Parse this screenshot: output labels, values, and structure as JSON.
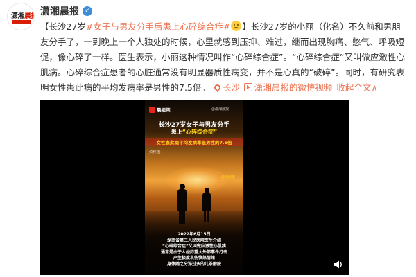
{
  "post": {
    "author": "潇湘晨报",
    "verified_icon": "verified-badge-icon",
    "avatar": {
      "line1a": "潇湘",
      "line1b": "晨报"
    },
    "segments": {
      "bracket_open": "【",
      "city": "长沙27岁",
      "hashtag": "#女子与男友分手后患上心碎综合症#",
      "emoji_icon": "sad-face-emoji",
      "bracket_close": "】",
      "body": "长沙27岁的小丽（化名）不久前和男朋友分手了，一到晚上一个人独处的时候，心里就感到压抑、难过，继而出现胸痛、憋气、呼吸短促，像心碎了一样。医生表示，小丽这种情况叫作“心碎综合症”。“心碎综合症”又叫做应激性心肌病。心碎综合症患者的心脏通常没有明显器质性病变，并不是心真的“破碎”。同时，有研究表明女性患此病的平均发病率是男性的7.5倍。",
      "location": "长沙",
      "video_link": "潇湘晨报的微博视频",
      "expand": "收起全文",
      "expand_arrow": "∧"
    }
  },
  "video": {
    "app_logo": "晨视频",
    "watermark": "@潇湘晨报",
    "title_line1": "长沙27岁女子与男友分手",
    "title_line2_pre": "患上",
    "title_line2_q": "“心碎综合症”",
    "banner": "女性患此病平均发病率是男性的7.5倍",
    "source": "资料图",
    "stamp": "潇湘晨报",
    "info_lines": [
      "2022年6月15日",
      "湖南省第二人民医院医生介绍",
      "“心碎综合症”又叫做应激性心肌病",
      "通常是由于人经历重大外部事件打击",
      "产生极度哀伤愤怒情绪",
      "身体随之分泌过多的儿茶酚胺"
    ],
    "mute_icon": "speaker-icon"
  }
}
